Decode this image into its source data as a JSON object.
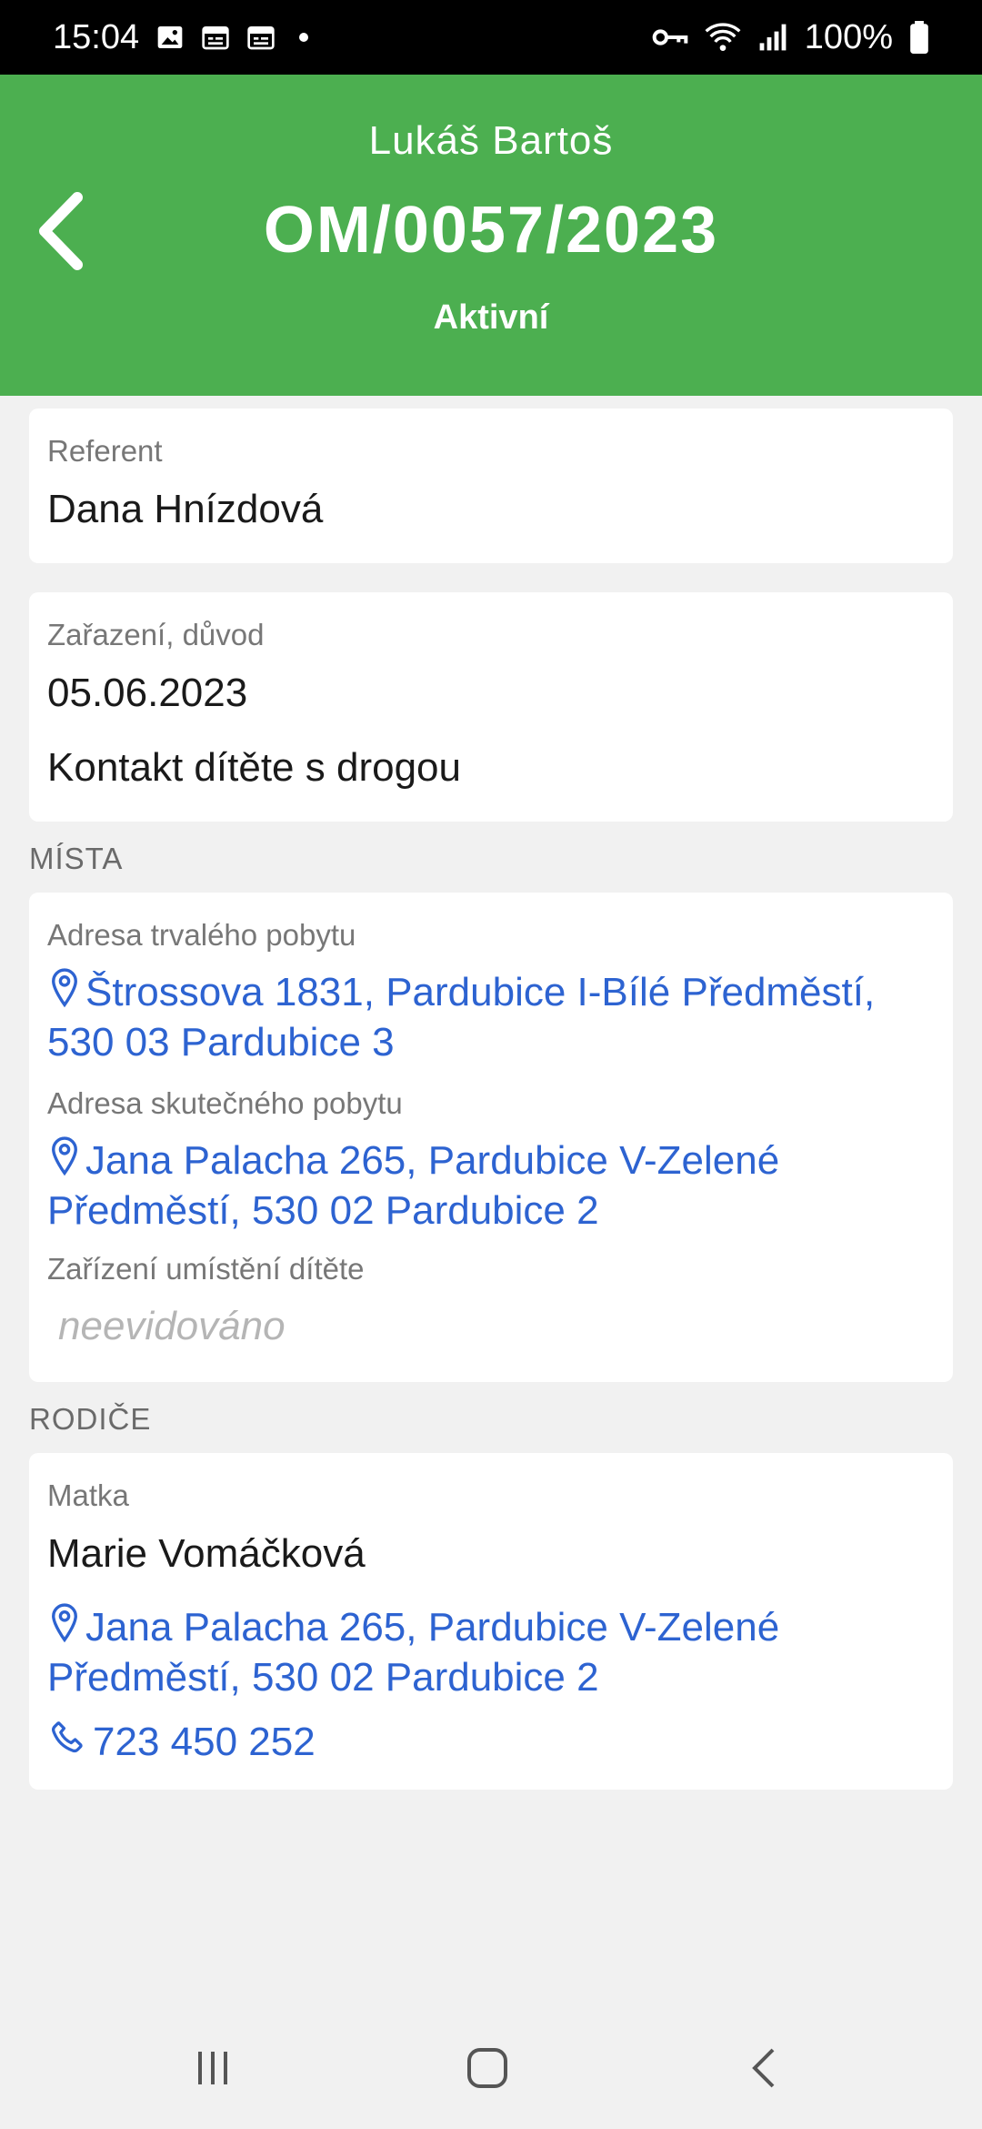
{
  "status_bar": {
    "time": "15:04",
    "battery": "100%",
    "icons_left": [
      "image-icon",
      "calendar-icon",
      "calendar-icon"
    ],
    "icons_right": [
      "key-icon",
      "wifi-icon",
      "signal-icon",
      "battery-icon"
    ]
  },
  "header": {
    "name": "Lukáš Bartoš",
    "case_id": "OM/0057/2023",
    "status": "Aktivní",
    "accent": "#4caf50"
  },
  "referent": {
    "label": "Referent",
    "value": "Dana Hnízdová"
  },
  "classification": {
    "label": "Zařazení, důvod",
    "date": "05.06.2023",
    "reason": "Kontakt dítěte s drogou"
  },
  "places": {
    "section_title": "MÍSTA",
    "permanent_label": "Adresa trvalého pobytu",
    "permanent_line1": "Štrossova 1831, Pardubice I-Bílé Předměstí,",
    "permanent_line2": "530 03  Pardubice 3",
    "actual_label": "Adresa skutečného pobytu",
    "actual_line1": "Jana Palacha 265, Pardubice V-Zelené",
    "actual_line2": "Předměstí, 530 02  Pardubice 2",
    "facility_label": "Zařízení umístění dítěte",
    "facility_value": "neevidováno"
  },
  "parents": {
    "section_title": "RODIČE",
    "mother_label": "Matka",
    "mother_name": "Marie Vomáčková",
    "mother_address_line1": "Jana Palacha 265, Pardubice V-Zelené",
    "mother_address_line2": "Předměstí, 530 02  Pardubice 2",
    "mother_phone": "723 450 252"
  },
  "colors": {
    "link": "#2d63d1",
    "background": "#f1f1f1"
  }
}
